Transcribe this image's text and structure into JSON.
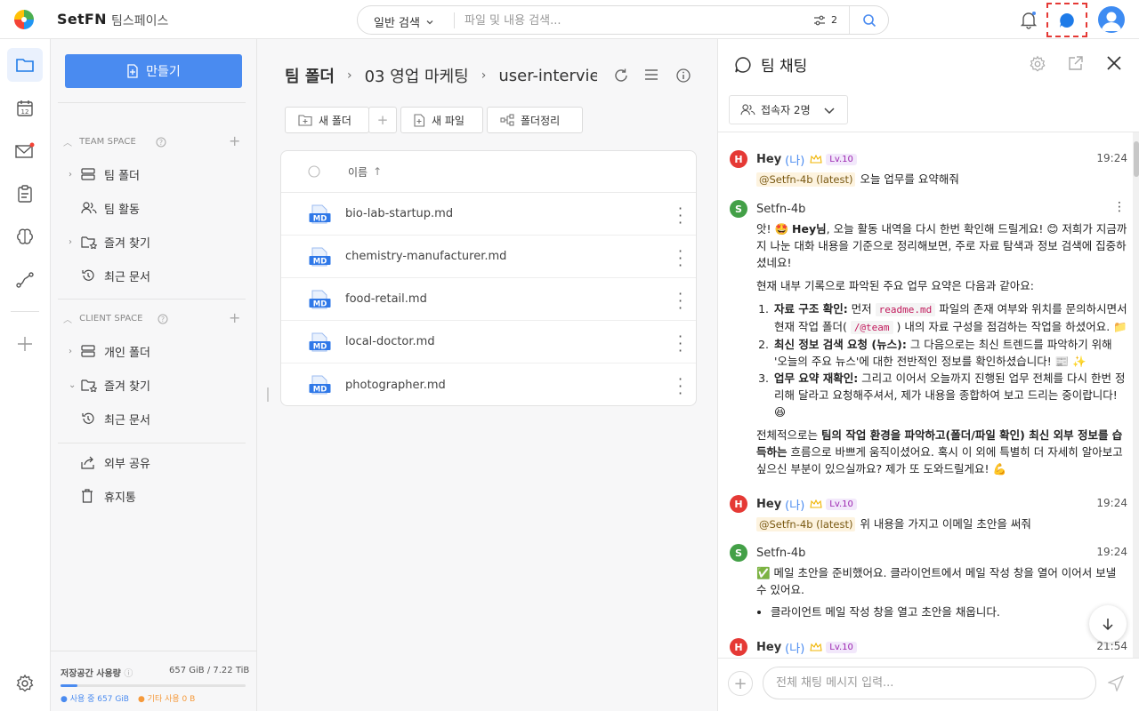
{
  "topbar": {
    "brand": "SetFN",
    "workspace": "팀스페이스",
    "search_mode": "일반 검색",
    "search_placeholder": "파일 및 내용 검색...",
    "filter_count": "2"
  },
  "sidebar": {
    "create_label": "만들기",
    "team_space": "TEAM SPACE",
    "team_items": [
      {
        "label": "팀 폴더",
        "icon": "server-icon"
      },
      {
        "label": "팀 활동",
        "icon": "users-icon"
      },
      {
        "label": "즐겨 찾기",
        "icon": "star-folder-icon"
      },
      {
        "label": "최근 문서",
        "icon": "history-icon"
      }
    ],
    "client_space": "CLIENT SPACE",
    "client_items": [
      {
        "label": "개인 폴더",
        "icon": "server-icon"
      },
      {
        "label": "즐겨 찾기",
        "icon": "star-folder-icon"
      },
      {
        "label": "최근 문서",
        "icon": "history-icon"
      }
    ],
    "extra_items": [
      {
        "label": "외부 공유",
        "icon": "share-icon"
      },
      {
        "label": "휴지통",
        "icon": "trash-icon"
      }
    ],
    "storage": {
      "label": "저장공간 사용량",
      "value": "657 GiB / 7.22 TiB",
      "used_fraction": 0.09,
      "used_legend": "● 사용 중 657 GiB",
      "other_legend": "● 기타 사용 0 B"
    }
  },
  "main": {
    "breadcrumb": [
      "팀 폴더",
      "03 영업 마케팅",
      "user-interviews"
    ],
    "toolbar": {
      "new_folder": "새 폴더",
      "new_file": "새 파일",
      "organize": "폴더정리"
    },
    "column_name": "이름",
    "file_badge": "MD",
    "files": [
      "bio-lab-startup.md",
      "chemistry-manufacturer.md",
      "food-retail.md",
      "local-doctor.md",
      "photographer.md"
    ]
  },
  "chat": {
    "title": "팀 채팅",
    "presence": "접속자 2명",
    "input_placeholder": "전체 채팅 메시지 입력...",
    "me_tag": "(나)",
    "level": "Lv.10",
    "user_initial": "H",
    "bot_initial": "S",
    "user_name": "Hey",
    "bot_name": "Setfn-4b",
    "mention": "@Setfn-4b (latest)",
    "m1": {
      "time": "19:24",
      "text": "오늘 업무를 요약해줘"
    },
    "m2": {
      "intro_a": "앗! 🤩 ",
      "intro_b": "Hey님",
      "intro_c": ", 오늘 활동 내역을 다시 한번 확인해 드릴게요! 😊 저희가 지금까지 나눈 대화 내용을 기준으로 정리해보면, 주로 자료 탐색과 정보 검색에 집중하셨네요!",
      "lead": "현재 내부 기록으로 파악된 주요 업무 요약은 다음과 같아요:",
      "li1_b": "자료 구조 확인:",
      "li1_a": " 먼저 ",
      "li1_code1": "readme.md",
      "li1_c": " 파일의 존재 여부와 위치를 문의하시면서 현재 작업 폴더( ",
      "li1_code2": "/@team",
      "li1_d": " ) 내의 자료 구성을 점검하는 작업을 하셨어요. 📁",
      "li2_b": "최신 정보 검색 요청 (뉴스):",
      "li2_a": " 그 다음으로는 최신 트렌드를 파악하기 위해 '오늘의 주요 뉴스'에 대한 전반적인 정보를 확인하셨습니다! 📰 ✨",
      "li3_b": "업무 요약 재확인:",
      "li3_a": " 그리고 이어서 오늘까지 진행된 업무 전체를 다시 한번 정리해 달라고 요청해주셔서, 제가 내용을 종합하여 보고 드리는 중이랍니다! 😆",
      "out_a": "전체적으로는 ",
      "out_b": "팀의 작업 환경을 파악하고(폴더/파일 확인) 최신 외부 정보를 습득하는",
      "out_c": " 흐름으로 바쁘게 움직이셨어요. 혹시 이 외에 특별히 더 자세히 알아보고 싶으신 부분이 있으실까요? 제가 또 도와드릴게요! 💪"
    },
    "m3": {
      "time": "19:24",
      "text": "위 내용을 가지고 이메일 초안을 써줘"
    },
    "m4": {
      "time": "19:24",
      "text": "✅ 메일 초안을 준비했어요. 클라이언트에서 메일 작성 창을 열어 이어서 보낼 수 있어요.",
      "bullet": "클라이언트 메일 작성 창을 열고 초안을 채웁니다."
    },
    "m5": {
      "time": "21:54"
    }
  }
}
